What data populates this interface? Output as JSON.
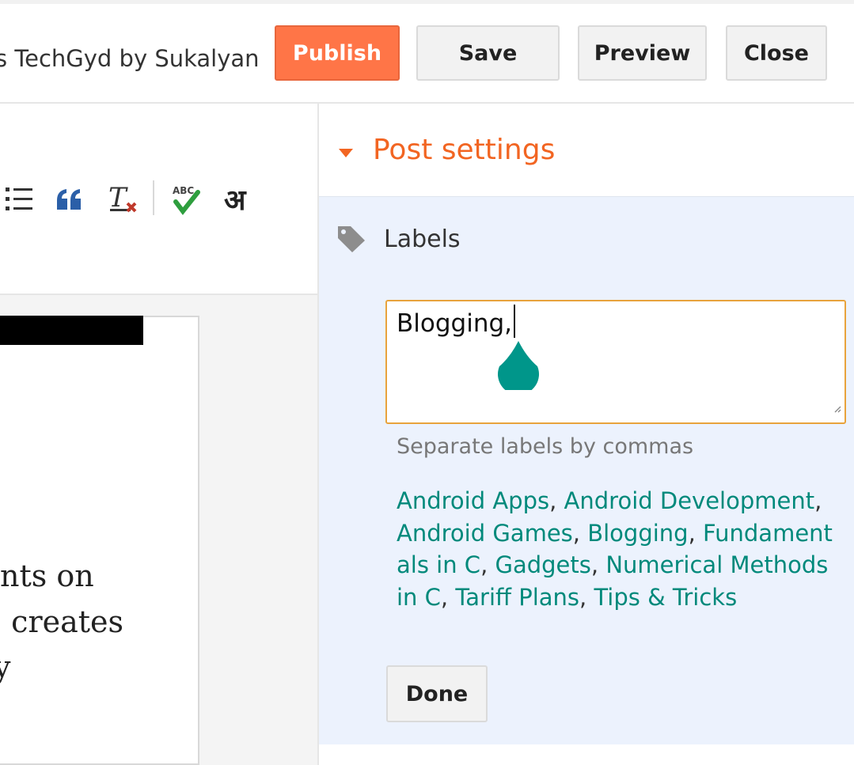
{
  "header": {
    "blog_title": "s TechGyd by Sukalyan",
    "publish_label": "Publish",
    "save_label": "Save",
    "preview_label": "Preview",
    "close_label": "Close"
  },
  "toolbar": {
    "icons": [
      "bulleted-list-icon",
      "blockquote-icon",
      "remove-formatting-icon",
      "spell-check-icon",
      "transliteration-icon"
    ],
    "transliterate_glyph": "अ"
  },
  "editor": {
    "lines": [
      "nts on",
      ". creates",
      "y"
    ]
  },
  "post_settings": {
    "title": "Post settings",
    "labels": {
      "heading": "Labels",
      "input_value": "Blogging,",
      "hint": "Separate labels by commas",
      "suggestions": [
        "Android Apps",
        "Android Development",
        "Android Games",
        "Blogging",
        "Fundamentals in C",
        "Gadgets",
        "Numerical Methods in C",
        "Tariff Plans",
        "Tips & Tricks"
      ],
      "done_label": "Done"
    }
  },
  "colors": {
    "accent_orange": "#f26522",
    "publish_bg": "#ff7547",
    "link_teal": "#00897b",
    "panel_bg": "#ecf2fd",
    "input_border": "#e8a33c"
  }
}
